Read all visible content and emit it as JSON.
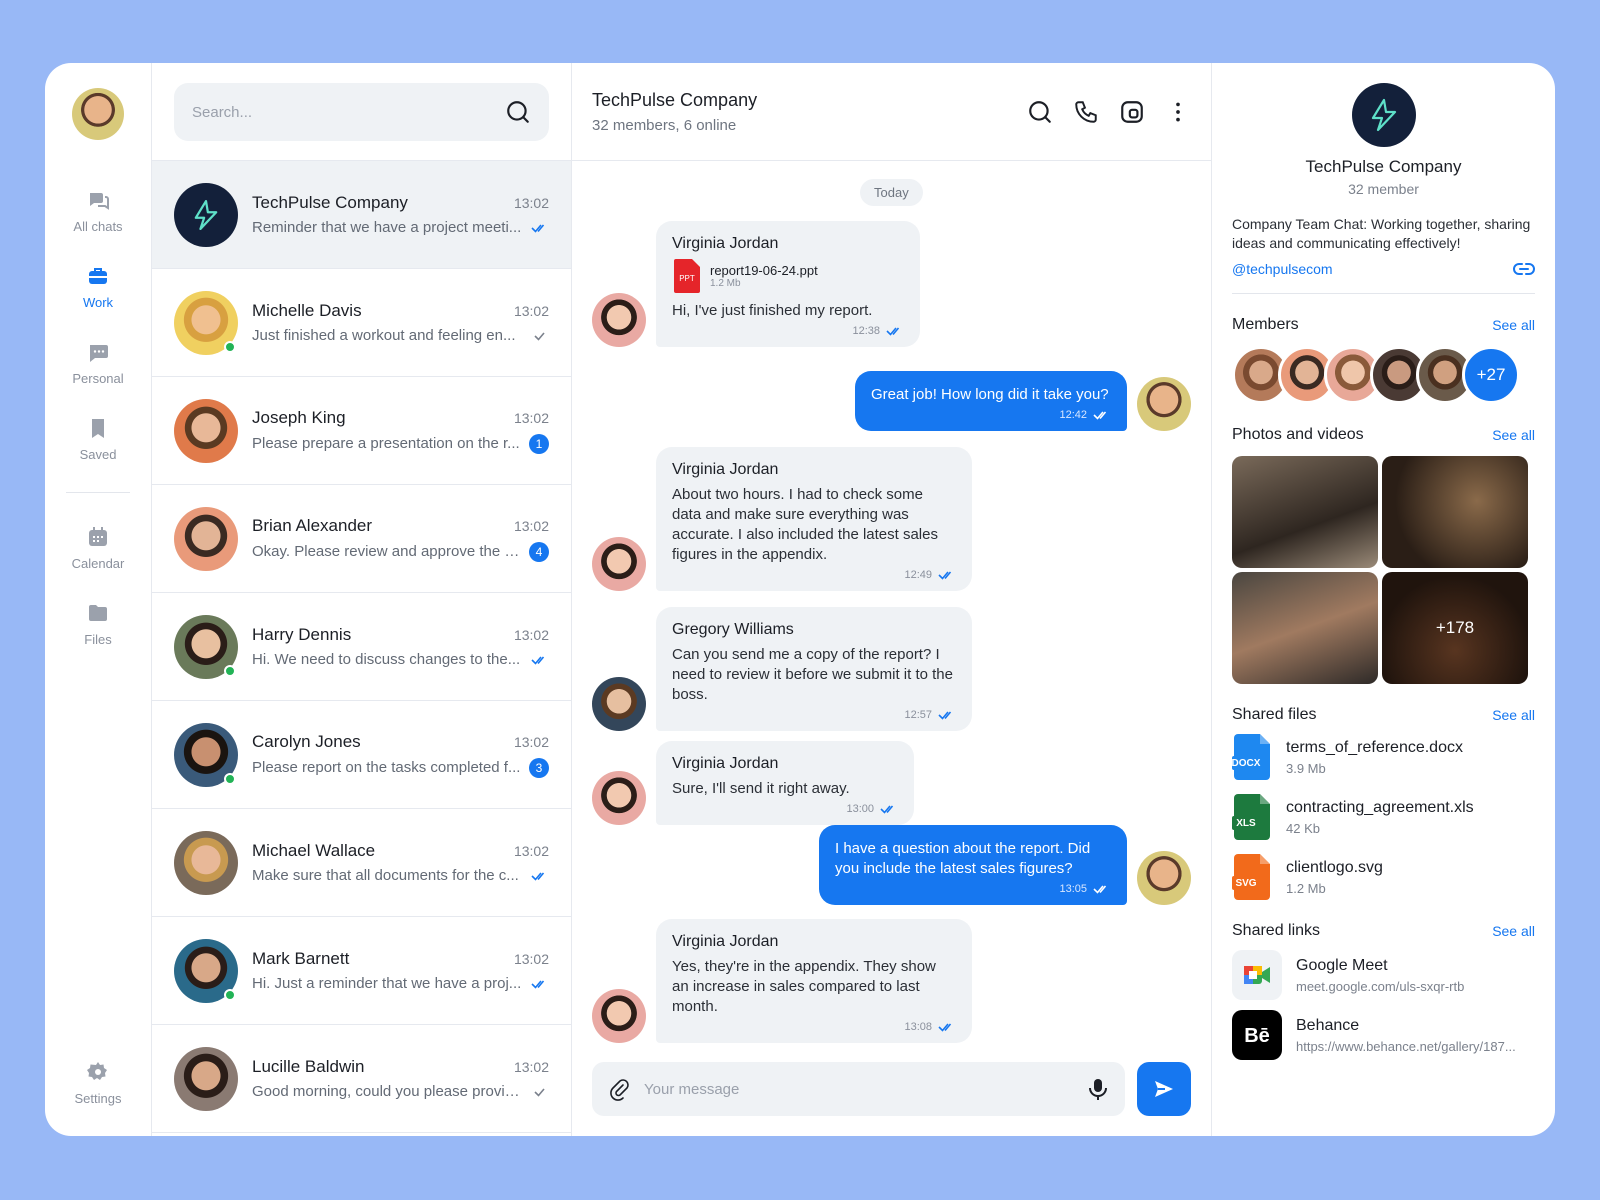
{
  "nav": {
    "items": [
      {
        "label": "All chats",
        "icon": "chats-icon"
      },
      {
        "label": "Work",
        "icon": "briefcase-icon"
      },
      {
        "label": "Personal",
        "icon": "message-icon"
      },
      {
        "label": "Saved",
        "icon": "bookmark-icon"
      },
      {
        "label": "Calendar",
        "icon": "calendar-icon"
      },
      {
        "label": "Files",
        "icon": "folder-icon"
      }
    ],
    "settings_label": "Settings"
  },
  "search": {
    "placeholder": "Search..."
  },
  "chats": [
    {
      "name": "TechPulse Company",
      "time": "13:02",
      "preview": "Reminder that we have a project meeti...",
      "status": "read"
    },
    {
      "name": "Michelle Davis",
      "time": "13:02",
      "preview": "Just finished a workout and feeling en...",
      "status": "sent"
    },
    {
      "name": "Joseph King",
      "time": "13:02",
      "preview": "Please prepare a presentation on the r...",
      "badge": "1"
    },
    {
      "name": "Brian Alexander",
      "time": "13:02",
      "preview": "Okay. Please review and approve the a...",
      "badge": "4"
    },
    {
      "name": "Harry Dennis",
      "time": "13:02",
      "preview": "Hi. We need to discuss changes to the...",
      "status": "read"
    },
    {
      "name": "Carolyn Jones",
      "time": "13:02",
      "preview": "Please report on the tasks completed f...",
      "badge": "3"
    },
    {
      "name": "Michael Wallace",
      "time": "13:02",
      "preview": "Make sure that all documents for the c...",
      "status": "read"
    },
    {
      "name": "Mark Barnett",
      "time": "13:02",
      "preview": "Hi. Just a reminder that we have a proj...",
      "status": "read"
    },
    {
      "name": "Lucille Baldwin",
      "time": "13:02",
      "preview": "Good morning, could you please provid...",
      "status": "sent"
    }
  ],
  "conversation": {
    "title": "TechPulse Company",
    "subtitle": "32 members, 6 online",
    "date_divider": "Today",
    "messages": [
      {
        "author": "Virginia Jordan",
        "file_name": "report19-06-24.ppt",
        "file_size": "1.2 Mb",
        "file_type": "PPT",
        "text": "Hi, I've just finished my report.",
        "time": "12:38"
      },
      {
        "author": "",
        "text": "Great job! How long did it take you?",
        "time": "12:42"
      },
      {
        "author": "Virginia Jordan",
        "text": "About two hours. I had to check some data and make sure everything was accurate. I also included the latest sales figures in the appendix.",
        "time": "12:49"
      },
      {
        "author": "Gregory Williams",
        "text": "Can you send me a copy of the report? I need to review it before we submit it to the boss.",
        "time": "12:57"
      },
      {
        "author": "Virginia Jordan",
        "text": "Sure, I'll send it right away.",
        "time": "13:00"
      },
      {
        "author": "",
        "text": "I have a question about the report. Did you include the latest sales figures?",
        "time": "13:05"
      },
      {
        "author": "Virginia Jordan",
        "text": "Yes, they're in the appendix. They show an increase in sales compared to last month.",
        "time": "13:08"
      }
    ],
    "composer_placeholder": "Your message"
  },
  "info": {
    "name": "TechPulse Company",
    "members_count": "32 member",
    "description": "Company Team Chat: Working together, sharing ideas and communicating effectively!",
    "handle": "@techpulsecom",
    "members_title": "Members",
    "members_more": "+27",
    "photos_title": "Photos and videos",
    "photos_more": "+178",
    "files_title": "Shared files",
    "files": [
      {
        "name": "terms_of_reference.docx",
        "size": "3.9 Mb",
        "type": "DOCX",
        "color": "#1e88f0"
      },
      {
        "name": "contracting_agreement.xls",
        "size": "42 Kb",
        "type": "XLS",
        "color": "#1d7a3e"
      },
      {
        "name": "clientlogo.svg",
        "size": "1.2 Mb",
        "type": "SVG",
        "color": "#f26a1b"
      }
    ],
    "links_title": "Shared links",
    "links": [
      {
        "name": "Google Meet",
        "url": "meet.google.com/uls-sxqr-rtb"
      },
      {
        "name": "Behance",
        "url": "https://www.behance.net/gallery/187..."
      }
    ],
    "see_all": "See all"
  },
  "colors": {
    "accent": "#1677f0",
    "background": "#98b8f6",
    "online": "#22b356"
  }
}
